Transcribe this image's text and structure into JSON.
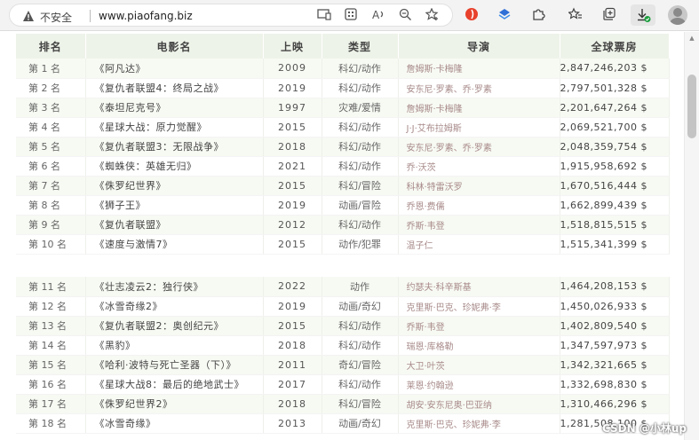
{
  "browser": {
    "security_label": "不安全",
    "url": "www.piaofang.biz",
    "accent_color": "#e8412c"
  },
  "table": {
    "headers": [
      "排名",
      "电影名",
      "上映",
      "类型",
      "导演",
      "全球票房"
    ],
    "group1": [
      {
        "rank": "第 1 名",
        "title": "《阿凡达》",
        "year": "2009",
        "genre": "科幻/动作",
        "director": "詹姆斯·卡梅隆",
        "gross": "2,847,246,203 $"
      },
      {
        "rank": "第 2 名",
        "title": "《复仇者联盟4：终局之战》",
        "year": "2019",
        "genre": "科幻/动作",
        "director": "安东尼·罗素、乔·罗素",
        "gross": "2,797,501,328 $"
      },
      {
        "rank": "第 3 名",
        "title": "《泰坦尼克号》",
        "year": "1997",
        "genre": "灾难/爱情",
        "director": "詹姆斯·卡梅隆",
        "gross": "2,201,647,264 $"
      },
      {
        "rank": "第 4 名",
        "title": "《星球大战：原力觉醒》",
        "year": "2015",
        "genre": "科幻/动作",
        "director": "J·J·艾布拉姆斯",
        "gross": "2,069,521,700 $"
      },
      {
        "rank": "第 5 名",
        "title": "《复仇者联盟3：无限战争》",
        "year": "2018",
        "genre": "科幻/动作",
        "director": "安东尼·罗素、乔·罗素",
        "gross": "2,048,359,754 $"
      },
      {
        "rank": "第 6 名",
        "title": "《蜘蛛侠：英雄无归》",
        "year": "2021",
        "genre": "科幻/动作",
        "director": "乔·沃茨",
        "gross": "1,915,958,692 $"
      },
      {
        "rank": "第 7 名",
        "title": "《侏罗纪世界》",
        "year": "2015",
        "genre": "科幻/冒险",
        "director": "科林·特雷沃罗",
        "gross": "1,670,516,444 $"
      },
      {
        "rank": "第 8 名",
        "title": "《狮子王》",
        "year": "2019",
        "genre": "动画/冒险",
        "director": "乔恩·费儒",
        "gross": "1,662,899,439 $"
      },
      {
        "rank": "第 9 名",
        "title": "《复仇者联盟》",
        "year": "2012",
        "genre": "科幻/动作",
        "director": "乔斯·韦登",
        "gross": "1,518,815,515 $"
      },
      {
        "rank": "第 10 名",
        "title": "《速度与激情7》",
        "year": "2015",
        "genre": "动作/犯罪",
        "director": "温子仁",
        "gross": "1,515,341,399 $"
      }
    ],
    "group2": [
      {
        "rank": "第 11 名",
        "title": "《壮志凌云2：独行侠》",
        "year": "2022",
        "genre": "动作",
        "director": "约瑟夫·科辛斯基",
        "gross": "1,464,208,153 $"
      },
      {
        "rank": "第 12 名",
        "title": "《冰雪奇缘2》",
        "year": "2019",
        "genre": "动画/奇幻",
        "director": "克里斯·巴克、珍妮弗·李",
        "gross": "1,450,026,933 $"
      },
      {
        "rank": "第 13 名",
        "title": "《复仇者联盟2：奥创纪元》",
        "year": "2015",
        "genre": "科幻/动作",
        "director": "乔斯·韦登",
        "gross": "1,402,809,540 $"
      },
      {
        "rank": "第 14 名",
        "title": "《黑豹》",
        "year": "2018",
        "genre": "科幻/动作",
        "director": "瑞恩·库格勒",
        "gross": "1,347,597,973 $"
      },
      {
        "rank": "第 15 名",
        "title": "《哈利·波特与死亡圣器（下）》",
        "year": "2011",
        "genre": "奇幻/冒险",
        "director": "大卫·叶茨",
        "gross": "1,342,321,665 $"
      },
      {
        "rank": "第 16 名",
        "title": "《星球大战8：最后的绝地武士》",
        "year": "2017",
        "genre": "科幻/动作",
        "director": "莱恩·约翰逊",
        "gross": "1,332,698,830 $"
      },
      {
        "rank": "第 17 名",
        "title": "《侏罗纪世界2》",
        "year": "2018",
        "genre": "科幻/冒险",
        "director": "胡安·安东尼奥·巴亚纳",
        "gross": "1,310,466,296 $"
      },
      {
        "rank": "第 18 名",
        "title": "《冰雪奇缘》",
        "year": "2013",
        "genre": "动画/奇幻",
        "director": "克里斯·巴克、珍妮弗·李",
        "gross": "1,281,508,100 $"
      }
    ]
  },
  "watermark": "CSDN @小林up"
}
